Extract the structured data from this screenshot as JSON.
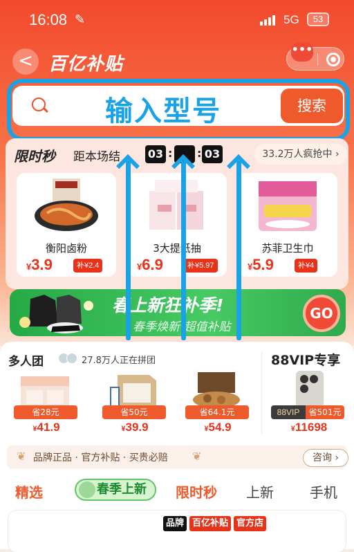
{
  "status_bar": {
    "time": "16:08",
    "network": "5G",
    "battery": "53"
  },
  "header": {
    "back_label": "<",
    "title": "百亿补贴",
    "more_label": "•••"
  },
  "search": {
    "placeholder": "输入型号",
    "button": "搜索"
  },
  "flash_sale": {
    "title": "限时秒",
    "subtitle": "距本场结",
    "countdown": [
      "03",
      "",
      "03"
    ],
    "rush_text": "33.2万人疯抢中 ›",
    "products": [
      {
        "name": "衡阳卤粉",
        "currency": "¥",
        "price": "3.9",
        "subsidy": "补¥2.4"
      },
      {
        "name": "3大提纸抽",
        "currency": "¥",
        "price": "6.9",
        "subsidy": "补¥5.97"
      },
      {
        "name": "苏菲卫生巾",
        "currency": "¥",
        "price": "5.9",
        "subsidy": "补¥4"
      }
    ]
  },
  "banner": {
    "title": "春上新狂补季!",
    "subtitle": "春季焕新 超值补贴",
    "go_label": "GO"
  },
  "group_buy": {
    "title": "多人团",
    "subtitle": "27.8万人正在拼团",
    "items": [
      {
        "tag": "省28元",
        "currency": "¥",
        "price": "41.9"
      },
      {
        "tag": "省50元",
        "currency": "¥",
        "price": "39.9"
      },
      {
        "tag": "省64.1元",
        "currency": "¥",
        "price": "54.9"
      }
    ]
  },
  "vip": {
    "title": "88VIP专享",
    "badge": "88VIP",
    "tag": "省501元",
    "currency": "¥",
    "price": "11698"
  },
  "trust_bar": {
    "text": "品牌正品 · 官方补贴 · 买贵必赔",
    "ask_button": "咨询 ›"
  },
  "tabs": [
    {
      "label": "精选"
    },
    {
      "label": "春季上新"
    },
    {
      "label": "限时秒"
    },
    {
      "label": "上新"
    },
    {
      "label": "手机"
    }
  ],
  "shop_card": {
    "logos": [
      "品牌",
      "百亿补贴",
      "官方店"
    ]
  },
  "colors": {
    "accent": "#ef5a2c",
    "annotation": "#1aa2e6",
    "price": "#e8331b",
    "banner_green": "#2faa4c"
  }
}
